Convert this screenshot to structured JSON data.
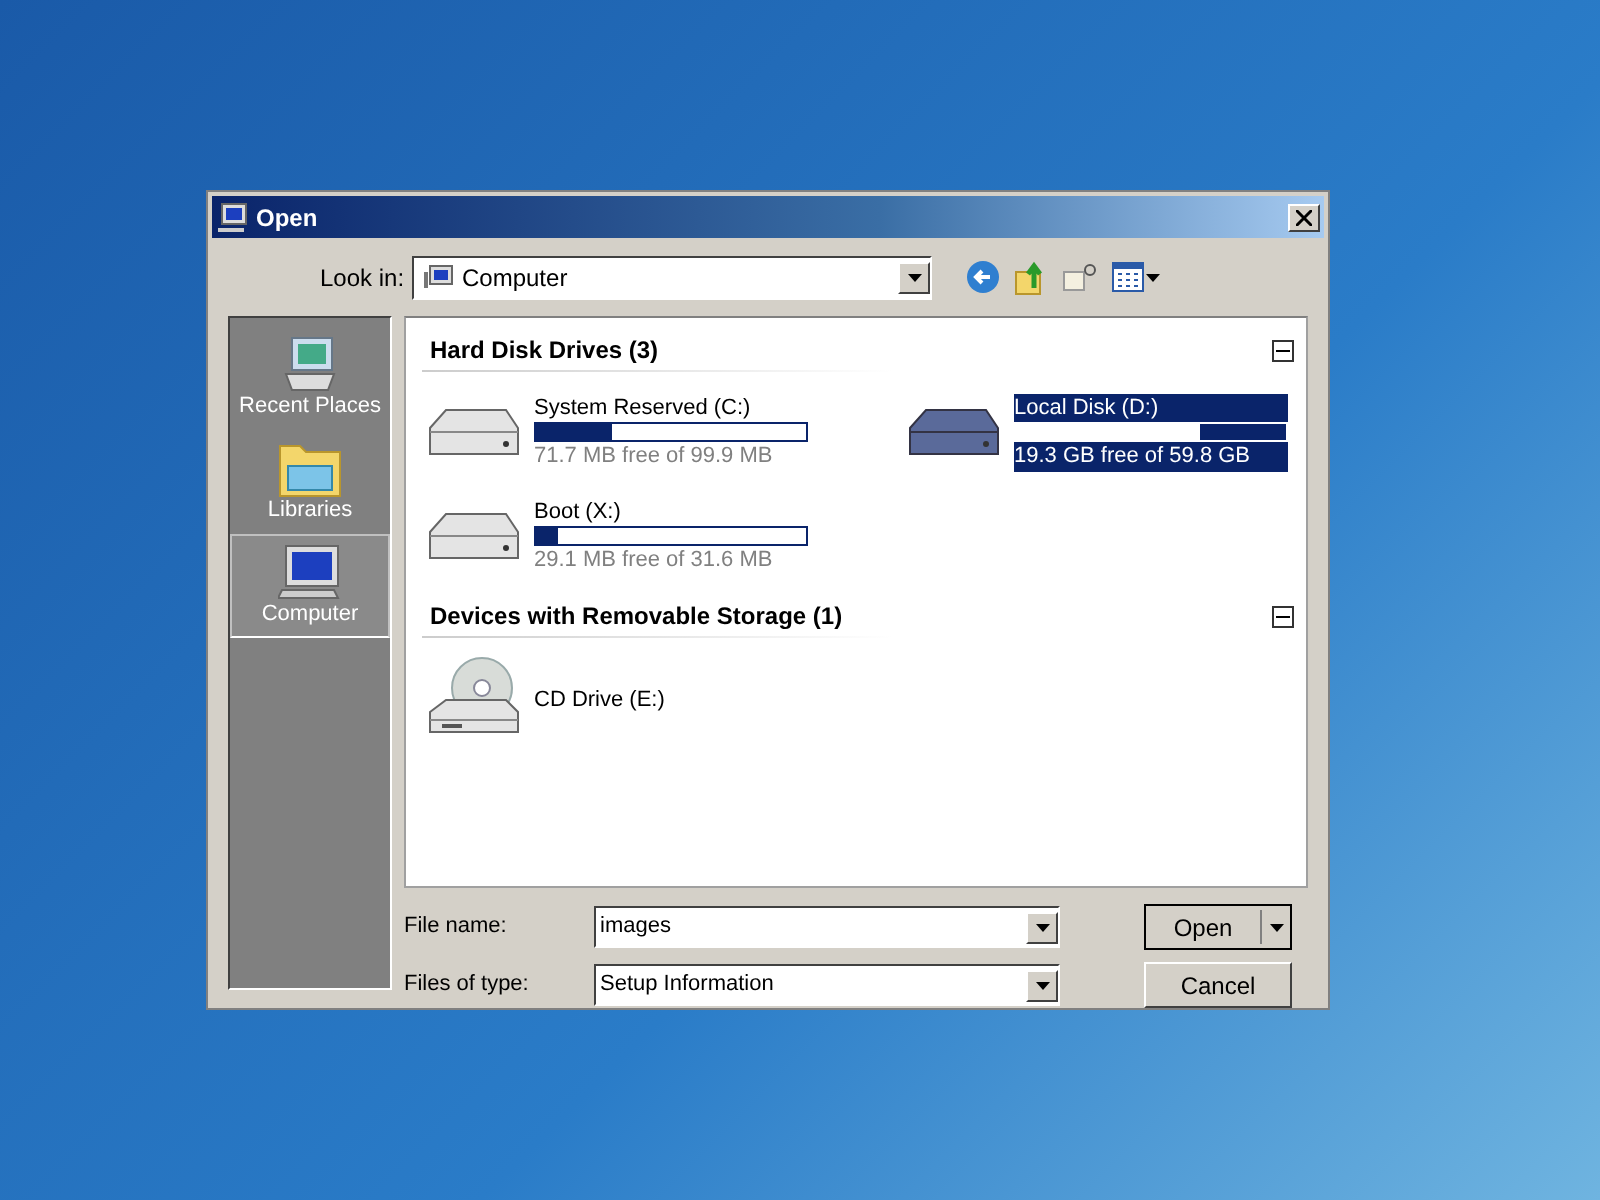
{
  "window": {
    "title": "Open"
  },
  "look_in": {
    "label": "Look in:",
    "value": "Computer"
  },
  "places": [
    {
      "label": "Recent Places",
      "kind": "recent",
      "selected": false
    },
    {
      "label": "Libraries",
      "kind": "libraries",
      "selected": false
    },
    {
      "label": "Computer",
      "kind": "computer",
      "selected": true
    }
  ],
  "groups": [
    {
      "title": "Hard Disk Drives (3)",
      "expanded": true,
      "items": [
        {
          "name": "System Reserved (C:)",
          "kind": "hdd",
          "level": 0.28,
          "free": "71.7 MB free of 99.9 MB",
          "selected": false
        },
        {
          "name": "Local Disk (D:)",
          "kind": "hdd",
          "level": 0.68,
          "free": "19.3 GB free of 59.8 GB",
          "selected": true
        },
        {
          "name": "Boot (X:)",
          "kind": "hdd",
          "level": 0.08,
          "free": "29.1 MB free of 31.6 MB",
          "selected": false
        }
      ]
    },
    {
      "title": "Devices with Removable Storage (1)",
      "expanded": true,
      "items": [
        {
          "name": "CD Drive (E:)",
          "kind": "cd",
          "selected": false
        }
      ]
    }
  ],
  "file_name": {
    "label": "File name:",
    "value": "images"
  },
  "file_type": {
    "label": "Files of type:",
    "value": "Setup Information"
  },
  "buttons": {
    "open": "Open",
    "cancel": "Cancel"
  }
}
